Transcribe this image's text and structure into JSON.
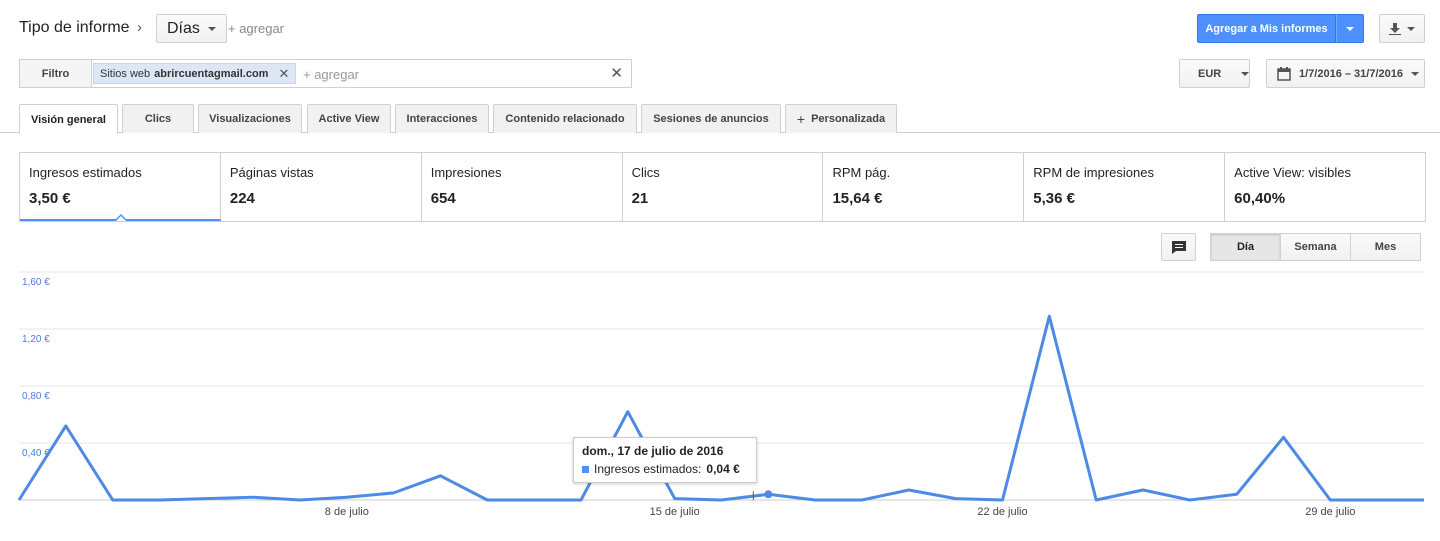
{
  "header": {
    "report_type_label": "Tipo de informe",
    "dimension": "Días",
    "add_label": "+ agregar",
    "add_to_reports_label": "Agregar a Mis informes"
  },
  "filter": {
    "label": "Filtro",
    "chip_prefix": "Sitios web",
    "chip_value": "abrircuentagmail.com",
    "add_placeholder": "+ agregar"
  },
  "currency": "EUR",
  "date_range": "1/7/2016 – 31/7/2016",
  "tabs": [
    {
      "label": "Visión general",
      "active": true
    },
    {
      "label": "Clics"
    },
    {
      "label": "Visualizaciones"
    },
    {
      "label": "Active View"
    },
    {
      "label": "Interacciones"
    },
    {
      "label": "Contenido relacionado"
    },
    {
      "label": "Sesiones de anuncios"
    },
    {
      "label": "Personalizada"
    }
  ],
  "metrics": [
    {
      "label": "Ingresos estimados",
      "value": "3,50 €"
    },
    {
      "label": "Páginas vistas",
      "value": "224"
    },
    {
      "label": "Impresiones",
      "value": "654"
    },
    {
      "label": "Clics",
      "value": "21"
    },
    {
      "label": "RPM pág.",
      "value": "15,64 €"
    },
    {
      "label": "RPM de impresiones",
      "value": "5,36 €"
    },
    {
      "label": "Active View: visibles",
      "value": "60,40%"
    }
  ],
  "granularity": {
    "options": [
      "Día",
      "Semana",
      "Mes"
    ],
    "selected": "Día"
  },
  "tooltip": {
    "date": "dom., 17 de julio de 2016",
    "series_label": "Ingresos estimados:",
    "value": "0,04 €"
  },
  "colors": {
    "accent": "#4d90fe",
    "line": "#4d8ae6"
  },
  "chart_data": {
    "type": "line",
    "x": [
      1,
      2,
      3,
      4,
      5,
      6,
      7,
      8,
      9,
      10,
      11,
      12,
      13,
      14,
      15,
      16,
      17,
      18,
      19,
      20,
      21,
      22,
      23,
      24,
      25,
      26,
      27,
      28,
      29,
      30,
      31
    ],
    "series": [
      {
        "values": [
          0.0,
          0.52,
          0.0,
          0.0,
          0.01,
          0.02,
          0.0,
          0.02,
          0.05,
          0.17,
          0.0,
          0.0,
          0.0,
          0.62,
          0.01,
          0.0,
          0.04,
          0.0,
          0.0,
          0.07,
          0.01,
          0.0,
          1.29,
          0.0,
          0.07,
          0.0,
          0.04,
          0.44,
          0.0,
          0.0,
          0.0
        ]
      }
    ],
    "yticks": [
      "1,60 €",
      "1,20 €",
      "0,80 €",
      "0,40 €"
    ],
    "ytick_values": [
      1.6,
      1.2,
      0.8,
      0.4
    ],
    "xticks": [
      {
        "label": "8 de julio",
        "day": 8
      },
      {
        "label": "15 de julio",
        "day": 15
      },
      {
        "label": "22 de julio",
        "day": 22
      },
      {
        "label": "29 de julio",
        "day": 29
      }
    ],
    "ylim": [
      0,
      1.6
    ],
    "grid": true,
    "highlight_day": 17
  }
}
